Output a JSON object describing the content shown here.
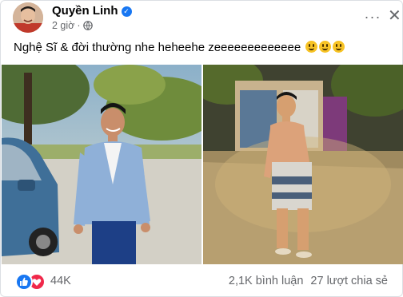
{
  "author": {
    "name": "Quyền Linh",
    "time": "2 giờ"
  },
  "caption": {
    "text": "Nghệ Sĩ & đời thường nhe heheehe zeeeeeeeeeeeee"
  },
  "header": {
    "more_label": "···",
    "close_label": "✕"
  },
  "reactions": {
    "count": "44K",
    "icons": [
      "like-icon",
      "love-icon"
    ]
  },
  "stats": {
    "comments": "2,1K bình luận",
    "shares": "27 lượt chia sẻ"
  },
  "colors": {
    "brand_blue": "#1877f2",
    "love_red": "#f0284a",
    "secondary_text": "#65676b"
  }
}
